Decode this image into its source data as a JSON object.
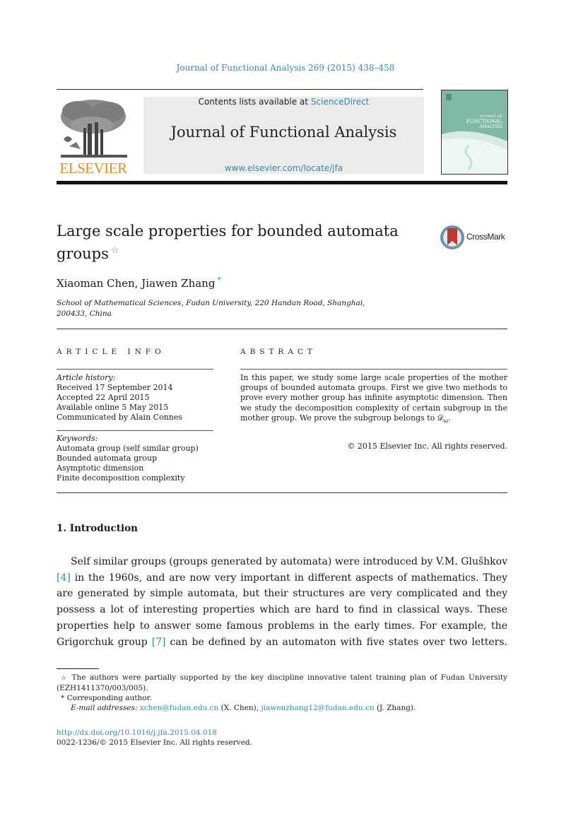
{
  "running_header": "Journal of Functional Analysis 269 (2015) 438–458",
  "masthead": {
    "publisher_logo": "ELSEVIER",
    "contents_prefix": "Contents lists available at ",
    "contents_link": "ScienceDirect",
    "journal_name": "Journal of Functional Analysis",
    "journal_url": "www.elsevier.com/locate/jfa",
    "cover_icon": "journal-cover-icon",
    "cover_text_line1": "JOURNAL OF",
    "cover_text_line2": "FUNCTIONAL",
    "cover_text_line3": "ANALYSIS",
    "colors": {
      "link": "#2a8bb5",
      "elsevier_orange": "#f08a1c",
      "cover_teal": "#7fb8a6",
      "box_gray": "#ebebeb"
    }
  },
  "article": {
    "title_line1": "Large scale properties for bounded automata",
    "title_line2": "groups",
    "title_footnote_mark": "☆",
    "crossmark_label": "CrossMark",
    "authors": "Xiaoman Chen, Jiawen Zhang",
    "corresponding_mark": "*",
    "affiliation_line1": "School of Mathematical Sciences, Fudan University, 220 Handan Road, Shanghai,",
    "affiliation_line2": "200433, China"
  },
  "article_info": {
    "heading": "ARTICLE INFO",
    "history_label": "Article history:",
    "history": [
      "Received 17 September 2014",
      "Accepted 22 April 2015",
      "Available online 5 May 2015",
      "Communicated by Alain Connes"
    ],
    "keywords_label": "Keywords:",
    "keywords": [
      "Automata group (self similar group)",
      "Bounded automata group",
      "Asymptotic dimension",
      "Finite decomposition complexity"
    ]
  },
  "abstract": {
    "heading": "ABSTRACT",
    "text": "In this paper, we study some large scale properties of the mother groups of bounded automata groups. First we give two methods to prove every mother group has infinite asymptotic dimension. Then we study the decomposition complexity of certain subgroup in the mother group. We prove the subgroup belongs to 𝒟",
    "subscript": "ω",
    "text_end": ".",
    "copyright": "© 2015 Elsevier Inc. All rights reserved."
  },
  "introduction": {
    "heading": "1.  Introduction",
    "p1": "Self similar groups (groups generated by automata) were introduced by V.M. Glušhkov ",
    "ref1": "[4]",
    "p2": " in the 1960s, and are now very important in different aspects of mathematics. They are generated by simple automata, but their structures are very complicated and they possess a lot of interesting properties which are hard to find in classical ways. These properties help to answer some famous problems in the early times. For example, the Grigorchuk group ",
    "ref2": "[7]",
    "p3": " can be defined by an automaton with five states over two letters."
  },
  "footnotes": {
    "fn1_mark": "☆",
    "fn1_text": " The authors were partially supported by the key discipline innovative talent training plan of Fudan University (EZH1411370/003/005).",
    "fn2_mark": "*",
    "fn2_text": " Corresponding author.",
    "email_label": "E-mail addresses:",
    "email1": "xchen@fudan.edu.cn",
    "email1_name": " (X. Chen), ",
    "email2": "jiawenzhang12@fudan.edu.cn",
    "email2_name": " (J. Zhang)."
  },
  "doi": "http://dx.doi.org/10.1016/j.jfa.2015.04.018",
  "issn_line": "0022-1236/© 2015 Elsevier Inc. All rights reserved."
}
